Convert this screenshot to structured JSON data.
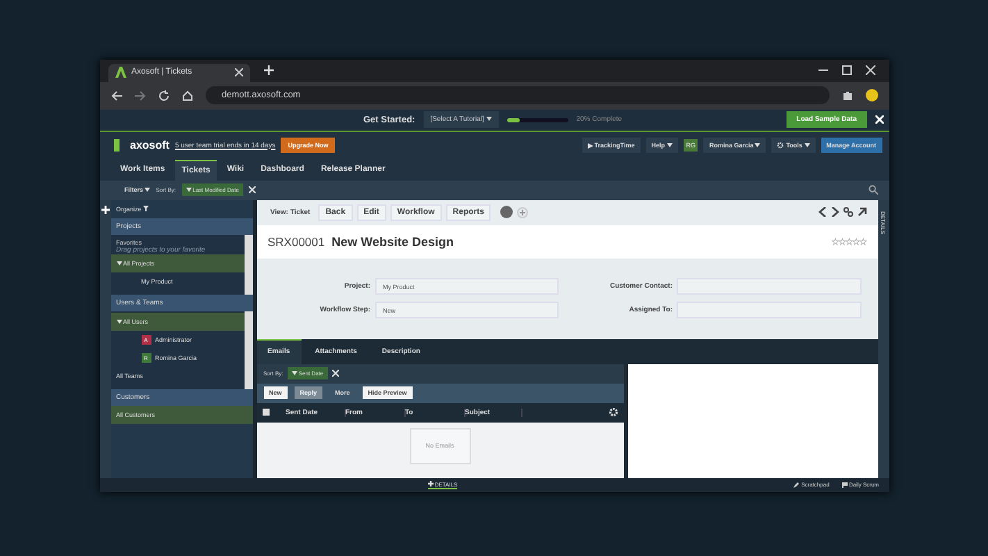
{
  "browser": {
    "tab_title": "Axosoft | Tickets",
    "url": "demott.axosoft.com"
  },
  "get_started": {
    "label": "Get Started:",
    "tutorial": "[Select A Tutorial]",
    "level": 0.2,
    "progress_text": "20% Complete",
    "load_button": "Load Sample Data"
  },
  "header": {
    "logo": "axosoft",
    "trial": "5 user team trial ends in 14 days",
    "upgrade": "Upgrade Now",
    "tracking": "TrackingTime",
    "help": "Help",
    "user_initials": "RG",
    "user_name": "Romina Garcia",
    "tools": "Tools",
    "manage": "Manage Account"
  },
  "nav": [
    {
      "label": "Work Items",
      "selected": false
    },
    {
      "label": "Tickets",
      "selected": true
    },
    {
      "label": "Wiki",
      "selected": false
    },
    {
      "label": "Dashboard",
      "selected": false
    },
    {
      "label": "Release Planner",
      "selected": false
    }
  ],
  "filter_bar": {
    "filters": "Filters",
    "sort_label": "Sort By:",
    "sort_chip": "Last Modified Date"
  },
  "sidebar": {
    "organize": "Organize",
    "projects": {
      "title": "Projects",
      "favorites": "Favorites",
      "hint": "Drag projects to your favorite",
      "tree": [
        {
          "label": "All Projects",
          "selected": true,
          "expanded": true,
          "children": [
            {
              "label": "My Product",
              "selected": false
            }
          ]
        }
      ]
    },
    "users": {
      "title": "Users & Teams",
      "tree": [
        {
          "label": "All Users",
          "selected": true,
          "expanded": true,
          "children": [
            {
              "label": "Administrator",
              "initials": "A",
              "color": "#b03048",
              "selected": false
            },
            {
              "label": "Romina Garcia",
              "initials": "R",
              "color": "#3f7a3a",
              "selected": false
            }
          ]
        }
      ],
      "teams": "All Teams"
    },
    "customers": {
      "title": "Customers",
      "items": [
        {
          "label": "All Customers",
          "selected": true
        }
      ]
    }
  },
  "ticket": {
    "view_label": "View: Ticket",
    "buttons": [
      "Back",
      "Edit",
      "Workflow",
      "Reports"
    ],
    "id": "SRX00001",
    "name": "New Website Design",
    "stars": 0,
    "fields": [
      {
        "label": "Project:",
        "value": "My Product"
      },
      {
        "label": "Customer Contact:"
      },
      {
        "label": "Workflow Step:",
        "value": "New"
      },
      {
        "label": "Assigned To:"
      }
    ]
  },
  "bottom_tabs": [
    {
      "label": "Emails",
      "selected": true
    },
    {
      "label": "Attachments",
      "selected": false
    },
    {
      "label": "Description",
      "selected": false
    }
  ],
  "emails": {
    "sort_label": "Sort By:",
    "sort_chip": "Sent Date",
    "buttons": [
      {
        "label": "New",
        "disabled": false
      },
      {
        "label": "Reply",
        "disabled": true
      },
      {
        "label": "More",
        "disabled": false
      },
      {
        "label": "Hide Preview",
        "disabled": false
      }
    ],
    "select_all_checked": false,
    "columns": [
      "Sent Date",
      "From",
      "To",
      "Subject"
    ],
    "empty": "No Emails"
  },
  "details_rail": "DETAILS",
  "footer": {
    "details": "DETAILS",
    "scratchpad": "Scratchpad",
    "daily_scrum": "Daily Scrum"
  }
}
